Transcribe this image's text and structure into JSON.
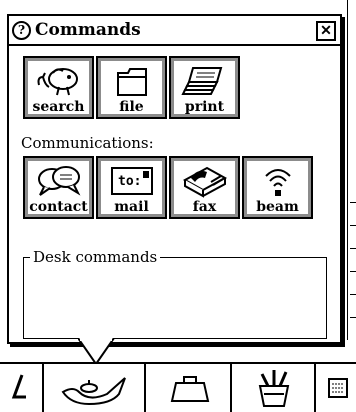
{
  "window": {
    "title": "Commands",
    "help_icon": "question-circle-icon",
    "close_icon": "close-x-icon"
  },
  "top_row": [
    {
      "label": "search",
      "icon": "dog-search-icon"
    },
    {
      "label": "file",
      "icon": "folder-icon"
    },
    {
      "label": "print",
      "icon": "paper-stack-icon"
    }
  ],
  "communications": {
    "label": "Communications:",
    "buttons": [
      {
        "label": "contact",
        "icon": "speech-bubbles-icon"
      },
      {
        "label": "mail",
        "icon": "envelope-to-icon",
        "envelope_text": "to:"
      },
      {
        "label": "fax",
        "icon": "fax-machine-icon"
      },
      {
        "label": "beam",
        "icon": "infrared-beam-icon"
      }
    ]
  },
  "desk": {
    "label": "Desk commands"
  },
  "tray": {
    "items": [
      "underline-glyph-icon",
      "genie-lamp-icon",
      "briefcase-icon",
      "tool-cup-icon",
      "keyboard-icon"
    ]
  },
  "colors": {
    "shadow": "#8c8c8c",
    "ink": "#000000",
    "paper": "#ffffff"
  }
}
